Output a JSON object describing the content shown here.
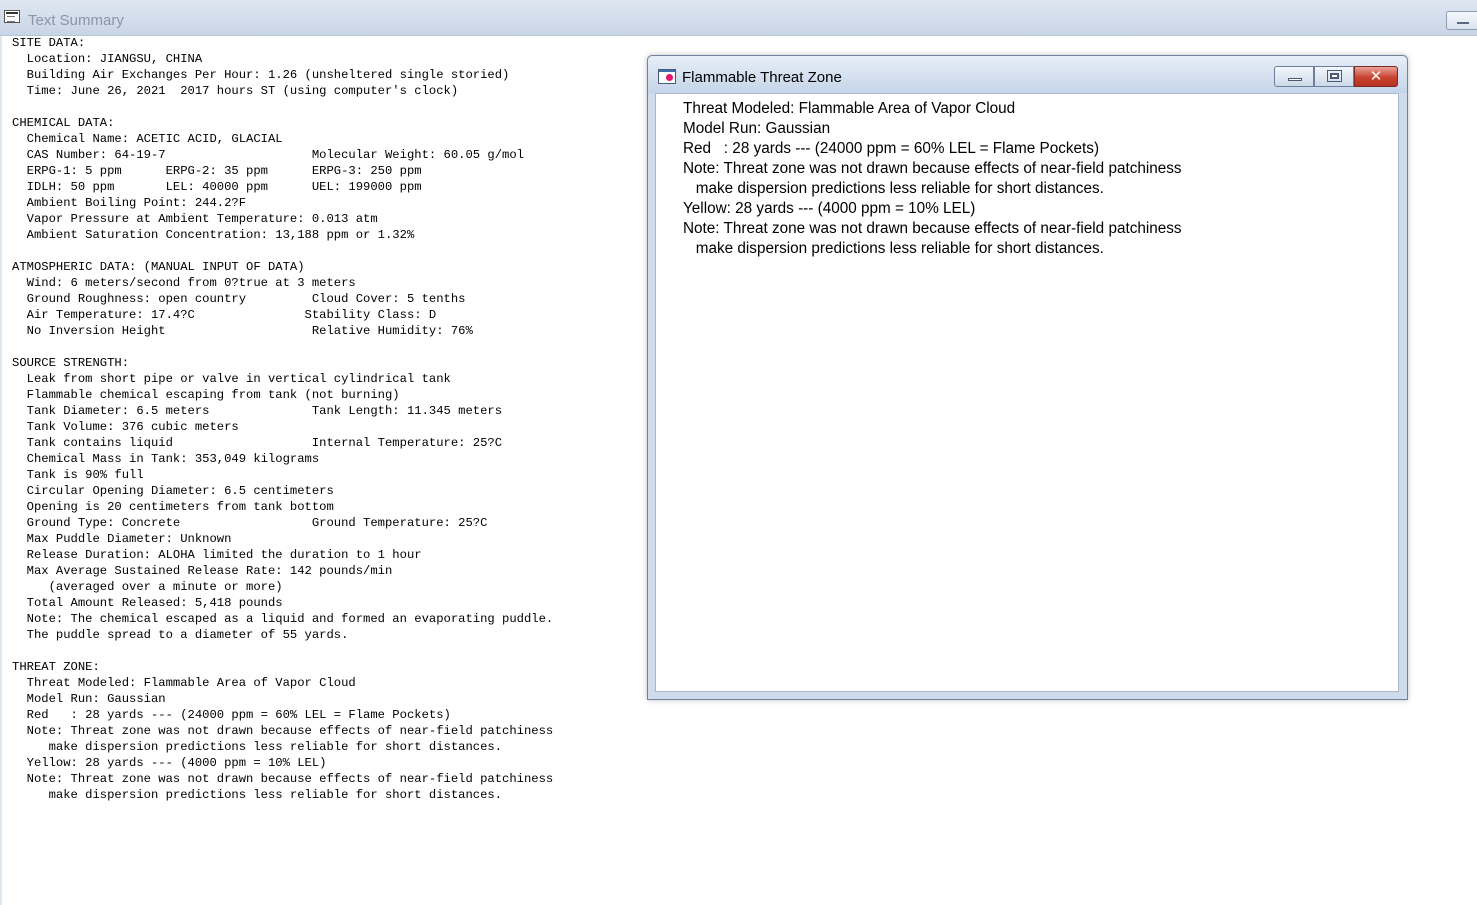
{
  "background_window": {
    "title": "Text Summary",
    "report_text": "SITE DATA:\n  Location: JIANGSU, CHINA\n  Building Air Exchanges Per Hour: 1.26 (unsheltered single storied)\n  Time: June 26, 2021  2017 hours ST (using computer's clock)\n\nCHEMICAL DATA:\n  Chemical Name: ACETIC ACID, GLACIAL\n  CAS Number: 64-19-7                    Molecular Weight: 60.05 g/mol\n  ERPG-1: 5 ppm      ERPG-2: 35 ppm      ERPG-3: 250 ppm\n  IDLH: 50 ppm       LEL: 40000 ppm      UEL: 199000 ppm\n  Ambient Boiling Point: 244.2?F\n  Vapor Pressure at Ambient Temperature: 0.013 atm\n  Ambient Saturation Concentration: 13,188 ppm or 1.32%\n\nATMOSPHERIC DATA: (MANUAL INPUT OF DATA)\n  Wind: 6 meters/second from 0?true at 3 meters\n  Ground Roughness: open country         Cloud Cover: 5 tenths\n  Air Temperature: 17.4?C               Stability Class: D\n  No Inversion Height                    Relative Humidity: 76%\n\nSOURCE STRENGTH:\n  Leak from short pipe or valve in vertical cylindrical tank\n  Flammable chemical escaping from tank (not burning)\n  Tank Diameter: 6.5 meters              Tank Length: 11.345 meters\n  Tank Volume: 376 cubic meters\n  Tank contains liquid                   Internal Temperature: 25?C\n  Chemical Mass in Tank: 353,049 kilograms\n  Tank is 90% full\n  Circular Opening Diameter: 6.5 centimeters\n  Opening is 20 centimeters from tank bottom\n  Ground Type: Concrete                  Ground Temperature: 25?C\n  Max Puddle Diameter: Unknown\n  Release Duration: ALOHA limited the duration to 1 hour\n  Max Average Sustained Release Rate: 142 pounds/min\n     (averaged over a minute or more)\n  Total Amount Released: 5,418 pounds\n  Note: The chemical escaped as a liquid and formed an evaporating puddle.\n  The puddle spread to a diameter of 55 yards.\n\nTHREAT ZONE:\n  Threat Modeled: Flammable Area of Vapor Cloud\n  Model Run: Gaussian\n  Red   : 28 yards --- (24000 ppm = 60% LEL = Flame Pockets)\n  Note: Threat zone was not drawn because effects of near-field patchiness\n     make dispersion predictions less reliable for short distances.\n  Yellow: 28 yards --- (4000 ppm = 10% LEL)\n  Note: Threat zone was not drawn because effects of near-field patchiness\n     make dispersion predictions less reliable for short distances."
  },
  "foreground_window": {
    "title": "Flammable Threat Zone",
    "close_glyph": "✕",
    "text": "Threat Modeled: Flammable Area of Vapor Cloud\nModel Run: Gaussian\nRed   : 28 yards --- (24000 ppm = 60% LEL = Flame Pockets)\nNote: Threat zone was not drawn because effects of near-field patchiness\n   make dispersion predictions less reliable for short distances.\nYellow: 28 yards --- (4000 ppm = 10% LEL)\nNote: Threat zone was not drawn because effects of near-field patchiness\n   make dispersion predictions less reliable for short distances."
  }
}
